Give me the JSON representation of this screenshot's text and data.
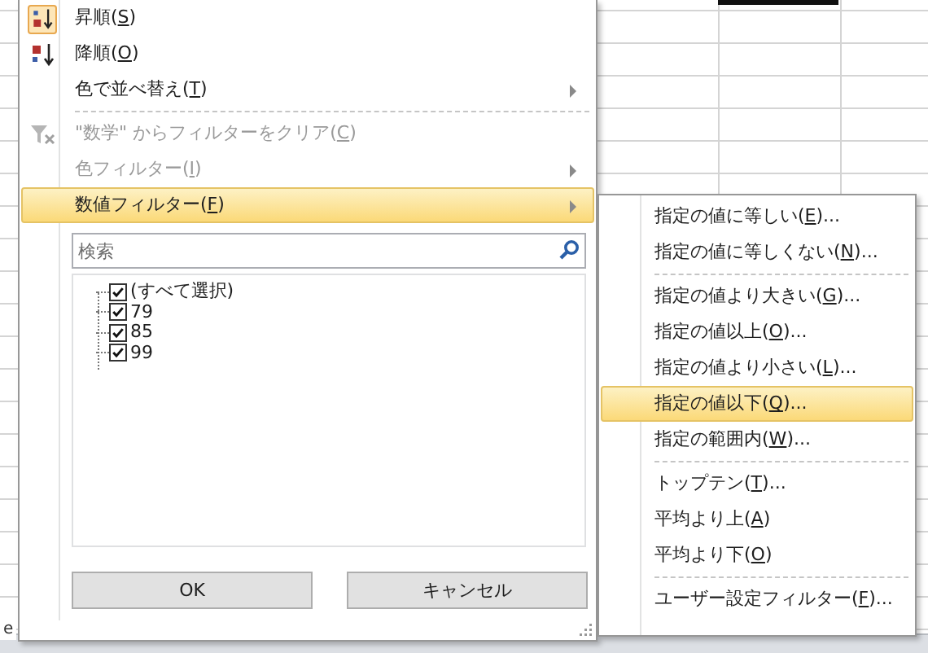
{
  "sheet": {
    "tab_text": "e"
  },
  "menu": {
    "items": [
      {
        "kind": "item",
        "checked": true,
        "before": "昇順(",
        "accel": "S",
        "after": ")",
        "disabled": false,
        "selected": false,
        "submenu": false
      },
      {
        "kind": "item",
        "checked": false,
        "before": "降順(",
        "accel": "O",
        "after": ")",
        "disabled": false,
        "selected": false,
        "submenu": false
      },
      {
        "kind": "item",
        "before": "色で並べ替え(",
        "accel": "T",
        "after": ")",
        "disabled": false,
        "selected": false,
        "submenu": true
      },
      {
        "kind": "separator"
      },
      {
        "kind": "item",
        "before": "\"数学\" からフィルターをクリア(",
        "accel": "C",
        "after": ")",
        "disabled": true,
        "selected": false,
        "submenu": false
      },
      {
        "kind": "item",
        "before": "色フィルター(",
        "accel": "I",
        "after": ")",
        "disabled": true,
        "selected": false,
        "submenu": true
      },
      {
        "kind": "item",
        "before": "数値フィルター(",
        "accel": "F",
        "after": ")",
        "disabled": false,
        "selected": true,
        "submenu": true
      }
    ],
    "search": {
      "placeholder": "検索"
    },
    "values": [
      {
        "label": "(すべて選択)",
        "checked": true
      },
      {
        "label": "79",
        "checked": true
      },
      {
        "label": "85",
        "checked": true
      },
      {
        "label": "99",
        "checked": true
      }
    ],
    "buttons": [
      "OK",
      "キャンセル"
    ]
  },
  "submenu": {
    "items": [
      {
        "kind": "item",
        "before": "指定の値に等しい(",
        "accel": "E",
        "after": ")...",
        "selected": false
      },
      {
        "kind": "item",
        "before": "指定の値に等しくない(",
        "accel": "N",
        "after": ")...",
        "selected": false
      },
      {
        "kind": "separator"
      },
      {
        "kind": "item",
        "before": "指定の値より大きい(",
        "accel": "G",
        "after": ")...",
        "selected": false
      },
      {
        "kind": "item",
        "before": "指定の値以上(",
        "accel": "O",
        "after": ")...",
        "selected": false
      },
      {
        "kind": "item",
        "before": "指定の値より小さい(",
        "accel": "L",
        "after": ")...",
        "selected": false
      },
      {
        "kind": "item",
        "before": "指定の値以下(",
        "accel": "Q",
        "after": ")...",
        "selected": true
      },
      {
        "kind": "item",
        "before": "指定の範囲内(",
        "accel": "W",
        "after": ")...",
        "selected": false
      },
      {
        "kind": "separator"
      },
      {
        "kind": "item",
        "before": "トップテン(",
        "accel": "T",
        "after": ")...",
        "selected": false
      },
      {
        "kind": "item",
        "before": "平均より上(",
        "accel": "A",
        "after": ")",
        "selected": false
      },
      {
        "kind": "item",
        "before": "平均より下(",
        "accel": "O",
        "after": ")",
        "selected": false
      },
      {
        "kind": "separator"
      },
      {
        "kind": "item",
        "before": "ユーザー設定フィルター(",
        "accel": "F",
        "after": ")...",
        "selected": false
      }
    ]
  }
}
